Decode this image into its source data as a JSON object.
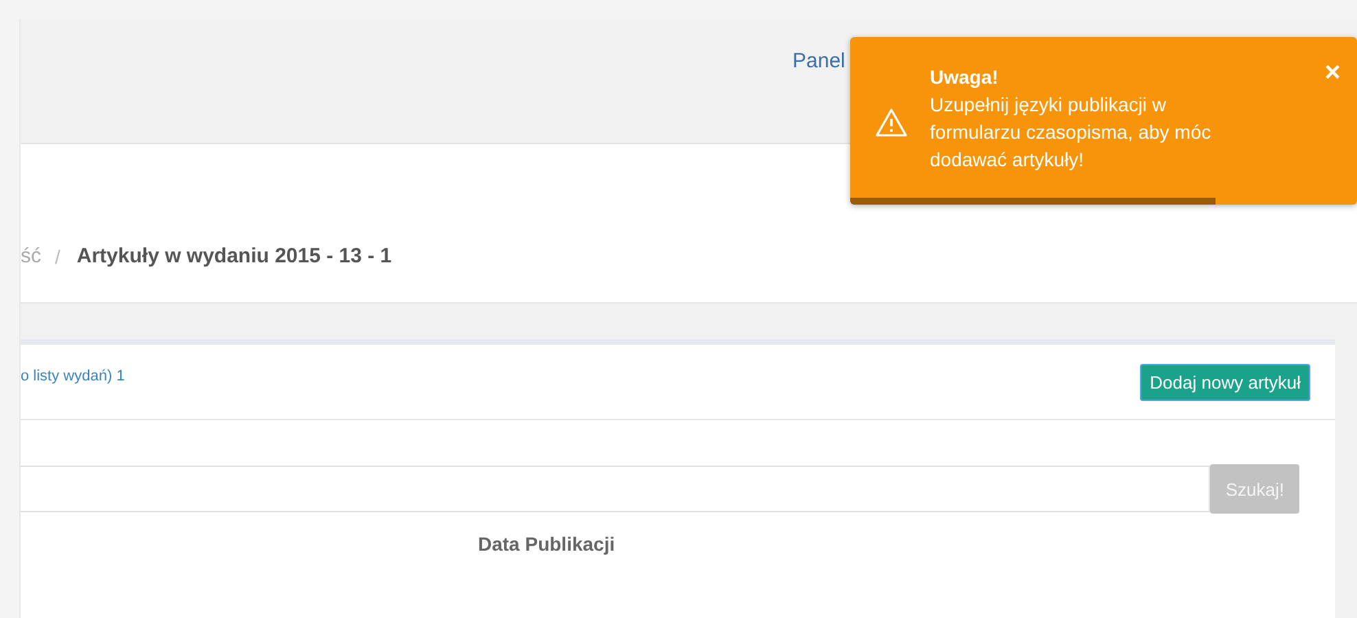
{
  "header": {
    "nav_link": "Panel"
  },
  "breadcrumb": {
    "items": [
      {
        "label": "ść",
        "current": false
      },
      {
        "label": "Artykuły w wydaniu 2015 - 13 - 1",
        "current": true
      }
    ],
    "separator": "/"
  },
  "panel": {
    "back_link": "o listy wydań) 1",
    "add_button": "Dodaj nowy artykuł"
  },
  "search": {
    "button": "Szukaj!",
    "disabled": true
  },
  "table": {
    "columns": [
      "Data Publikacji"
    ]
  },
  "toast": {
    "kind": "warning",
    "title": "Uwaga!",
    "message": "Uzupełnij języki publikacji w formularzu czasopisma, aby móc dodawać artykuły!",
    "close": "×",
    "level": 0.72
  }
}
